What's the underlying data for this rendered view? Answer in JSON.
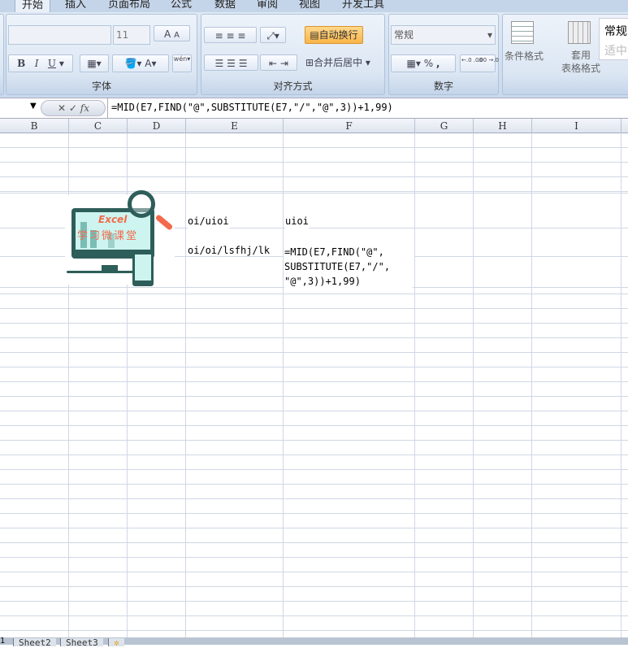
{
  "ribbon": {
    "tabs": [
      {
        "label": "开始",
        "active": true
      },
      {
        "label": "插入"
      },
      {
        "label": "页面布局"
      },
      {
        "label": "公式"
      },
      {
        "label": "数据"
      },
      {
        "label": "审阅"
      },
      {
        "label": "视图"
      },
      {
        "label": "开发工具"
      }
    ],
    "font_group": {
      "label": "字体",
      "font_name": "",
      "font_size": "11",
      "grow": "A",
      "shrink": "A",
      "bold": "B",
      "italic": "I",
      "underline": "U",
      "font_color": "A",
      "phonetic": "wén"
    },
    "align_group": {
      "label": "对齐方式",
      "wrap_text": "自动换行",
      "merge_center": "合并后居中"
    },
    "number_group": {
      "label": "数字",
      "format": "常规",
      "percent": "%",
      "comma": ",",
      "inc_decimal": "←.0 .00",
      "dec_decimal": ".00 →.0"
    },
    "styles_group": {
      "conditional": "条件格式",
      "table_format_1": "套用",
      "table_format_2": "表格格式",
      "style_normal": "常规",
      "style_neutral": "适中"
    }
  },
  "formula_bar": {
    "fx": "fx",
    "formula": "=MID(E7,FIND(\"@\",SUBSTITUTE(E7,\"/\",\"@\",3))+1,99)"
  },
  "columns": [
    "B",
    "C",
    "D",
    "E",
    "F",
    "G",
    "H",
    "I"
  ],
  "cells": {
    "E_row1": "oi/uioi",
    "F_row1": "uioi",
    "E_row2": "oi/oi/lsfhj/lk",
    "F_row2_lines": [
      "=MID(E7,FIND(\"@\",",
      "SUBSTITUTE(E7,\"/\",",
      "\"@\",3))+1,99)"
    ]
  },
  "logo": {
    "text1": "Excel",
    "text2": "学习微课堂",
    "colors": {
      "screen": "#cdf4ef",
      "frame": "#2e5e5a",
      "accent": "#f26a4b"
    }
  },
  "sheet_tabs": [
    "1",
    "Sheet2",
    "Sheet3"
  ]
}
